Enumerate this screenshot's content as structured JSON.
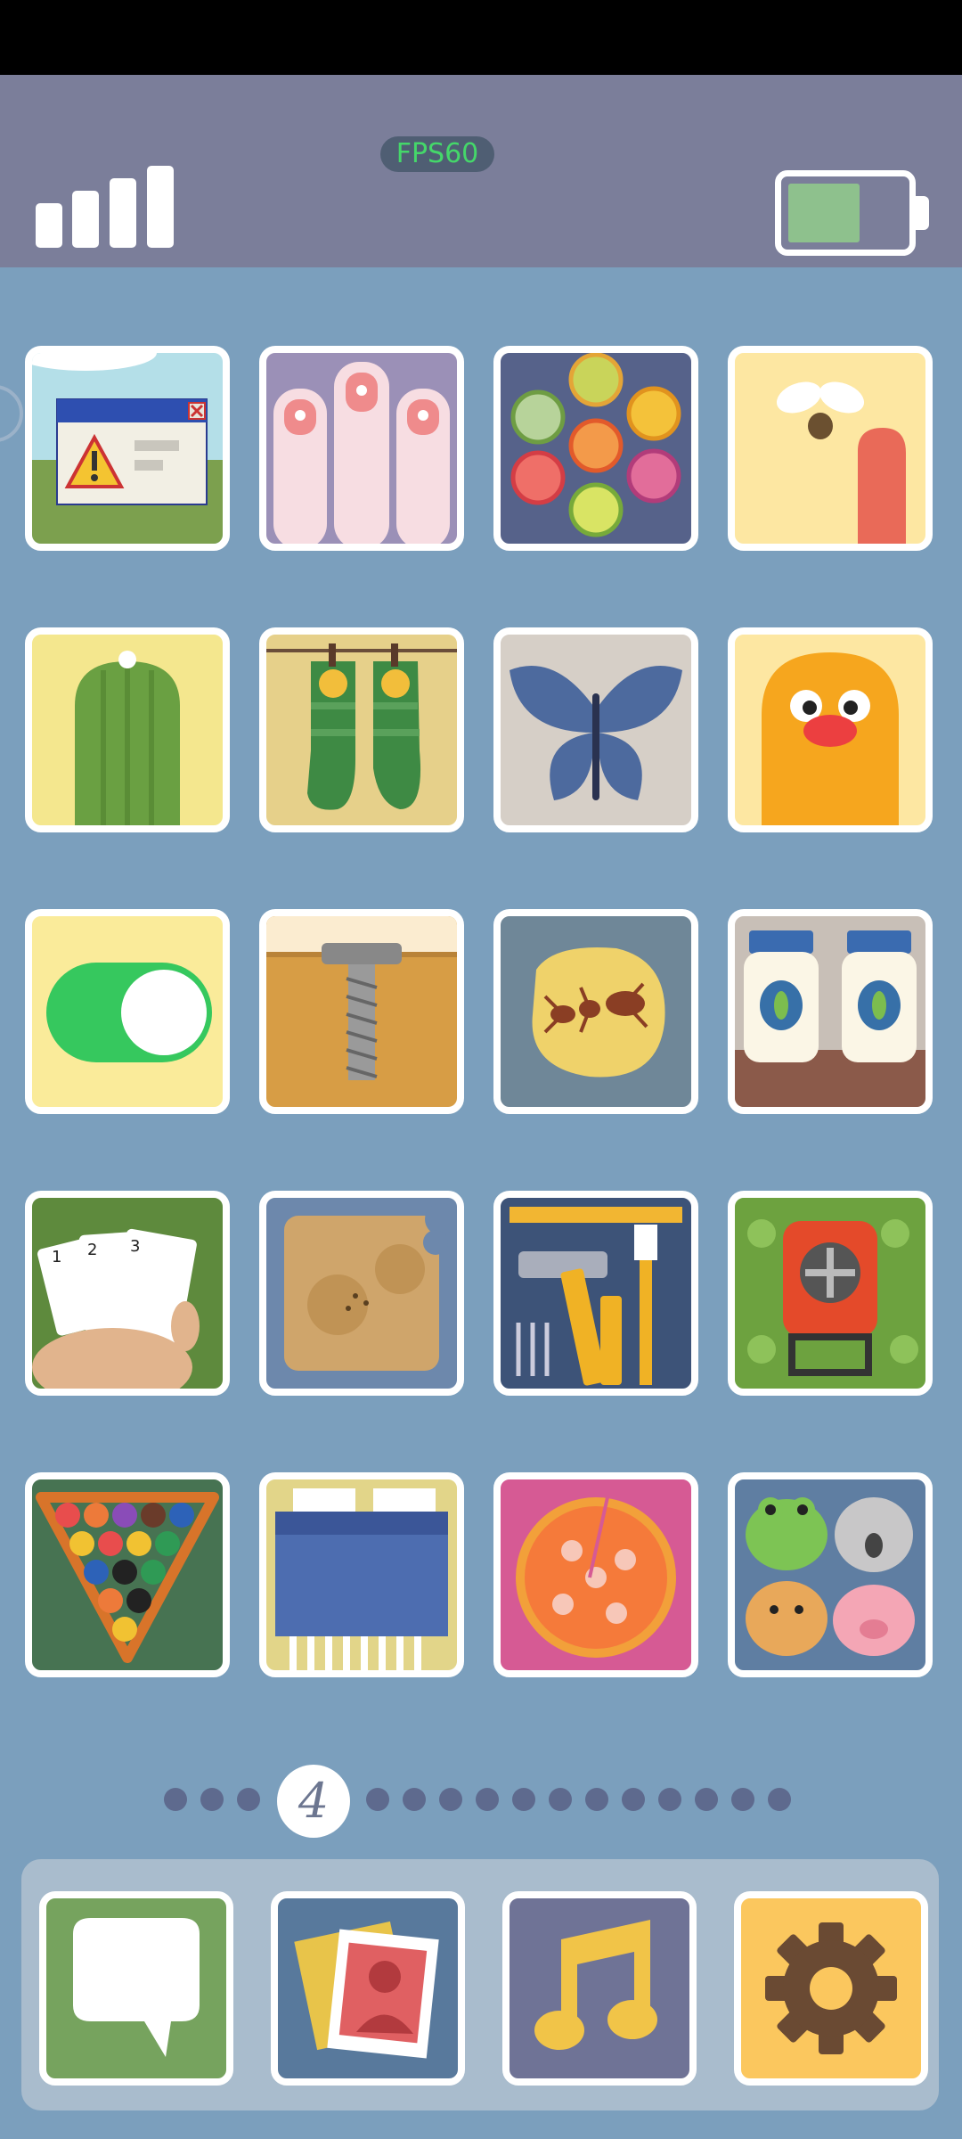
{
  "status_bar": {
    "signal_icon": "signal-bars-icon",
    "fps_label": "FPS60",
    "battery_icon": "battery-icon",
    "battery_level": 0.5
  },
  "apps": [
    {
      "icon": "error-dialog-icon",
      "bg": "#b4dfe8"
    },
    {
      "icon": "fingernails-icon",
      "bg": "#9b90b7"
    },
    {
      "icon": "fruit-slices-icon",
      "bg": "#56628a"
    },
    {
      "icon": "fly-and-finger-icon",
      "bg": "#fde7a2"
    },
    {
      "icon": "cucumber-icon",
      "bg": "#f4e78e"
    },
    {
      "icon": "tiger-socks-icon",
      "bg": "#e6d08a"
    },
    {
      "icon": "blue-butterfly-icon",
      "bg": "#d6cfc7"
    },
    {
      "icon": "orange-blob-face-icon",
      "bg": "#fde7a2"
    },
    {
      "icon": "toggle-switch-icon",
      "bg": "#faeb9a"
    },
    {
      "icon": "screw-in-wood-icon",
      "bg": "#d79d45"
    },
    {
      "icon": "ant-on-cracker-icon",
      "bg": "#6f8798"
    },
    {
      "icon": "pickle-jars-icon",
      "bg": "#c8bfb7"
    },
    {
      "icon": "playing-cards-icon",
      "bg": "#5e8a3d"
    },
    {
      "icon": "bitten-toast-icon",
      "bg": "#6d88ac"
    },
    {
      "icon": "tool-kit-icon",
      "bg": "#3d5378"
    },
    {
      "icon": "lawn-mower-icon",
      "bg": "#6da23f"
    },
    {
      "icon": "pool-balls-rack-icon",
      "bg": "#477352"
    },
    {
      "icon": "paper-shredder-icon",
      "bg": "#e2d589"
    },
    {
      "icon": "pizza-icon",
      "bg": "#d65a94"
    },
    {
      "icon": "animal-faces-icon",
      "bg": "#5f7ea2"
    }
  ],
  "pagination": {
    "current_page": "4",
    "dots_before": 3,
    "dots_after": 12
  },
  "dock": [
    {
      "icon": "messages-icon",
      "bg": "#76a35e"
    },
    {
      "icon": "photos-icon",
      "bg": "#58799c"
    },
    {
      "icon": "music-icon",
      "bg": "#6f7396"
    },
    {
      "icon": "settings-gear-icon",
      "bg": "#fbc75e"
    }
  ]
}
